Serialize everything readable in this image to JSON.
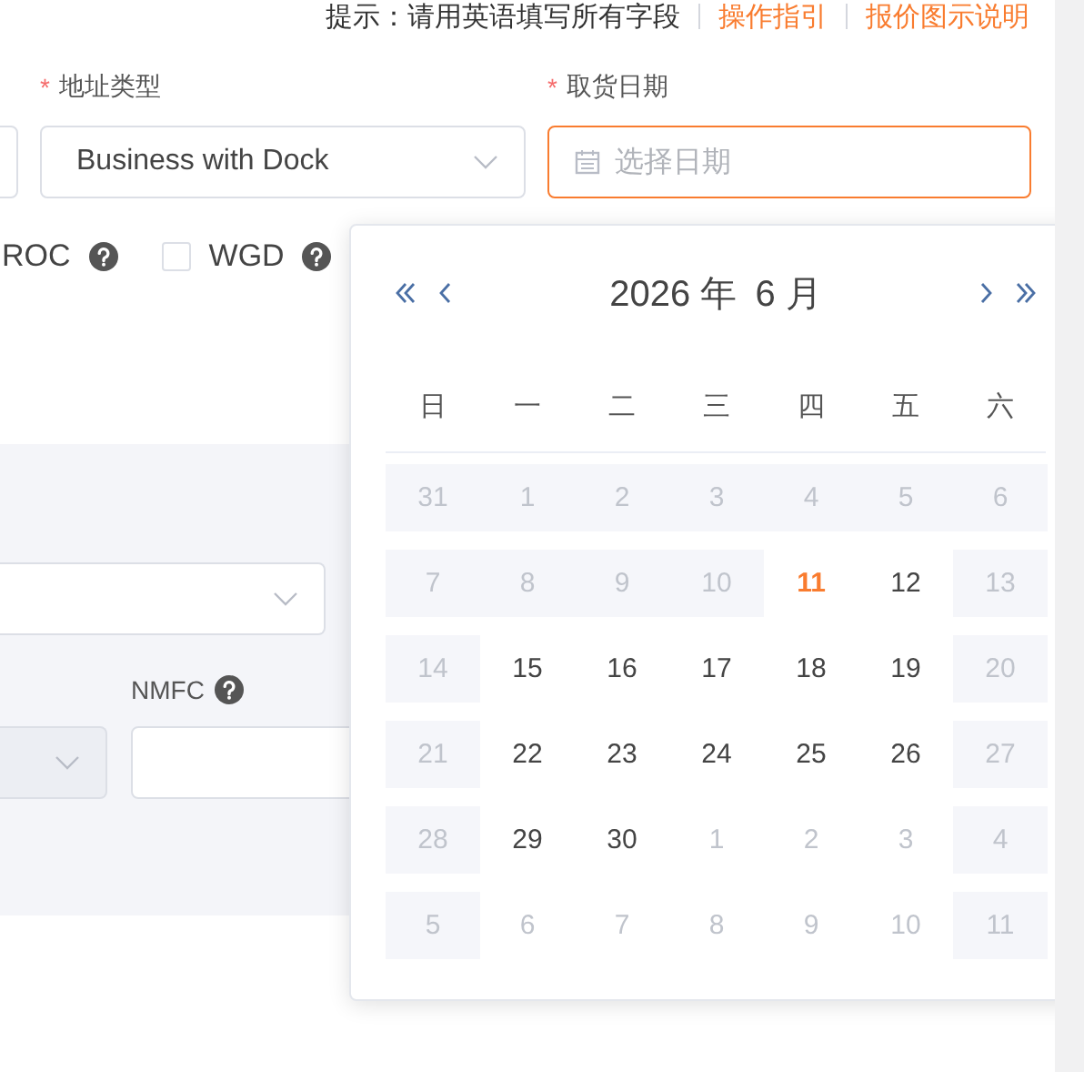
{
  "hint_bar": {
    "text": "提示：请用英语填写所有字段",
    "links": [
      "操作指引",
      "报价图示说明"
    ]
  },
  "fields": [
    {
      "kind": "input"
    },
    {
      "kind": "select",
      "marker": "*",
      "label": "地址类型",
      "value": "Business with Dock"
    },
    {
      "kind": "date",
      "marker": "*",
      "label": "取货日期",
      "placeholder": "选择日期",
      "focused": true
    }
  ],
  "options": [
    {
      "kind": "text",
      "label": "ROC",
      "help": true
    },
    {
      "kind": "checkbox",
      "label": "WGD",
      "checked": false,
      "help": true
    }
  ],
  "freight_panel": {
    "selects": [
      {
        "disabled": false
      },
      {
        "disabled": true
      }
    ],
    "nmfc": {
      "label": "NMFC",
      "help": true
    }
  },
  "calendar": {
    "year": "2026 年",
    "month": "6 月",
    "weekdays": [
      "日",
      "一",
      "二",
      "三",
      "四",
      "五",
      "六"
    ],
    "days": [
      {
        "label": "31",
        "kind": "disabled"
      },
      {
        "label": "1",
        "kind": "disabled"
      },
      {
        "label": "2",
        "kind": "disabled"
      },
      {
        "label": "3",
        "kind": "disabled"
      },
      {
        "label": "4",
        "kind": "disabled"
      },
      {
        "label": "5",
        "kind": "disabled"
      },
      {
        "label": "6",
        "kind": "disabled"
      },
      {
        "label": "7",
        "kind": "disabled"
      },
      {
        "label": "8",
        "kind": "disabled"
      },
      {
        "label": "9",
        "kind": "disabled"
      },
      {
        "label": "10",
        "kind": "disabled"
      },
      {
        "label": "11",
        "kind": "today"
      },
      {
        "label": "12",
        "kind": "normal"
      },
      {
        "label": "13",
        "kind": "disabled"
      },
      {
        "label": "14",
        "kind": "disabled"
      },
      {
        "label": "15",
        "kind": "normal"
      },
      {
        "label": "16",
        "kind": "normal"
      },
      {
        "label": "17",
        "kind": "normal"
      },
      {
        "label": "18",
        "kind": "normal"
      },
      {
        "label": "19",
        "kind": "normal"
      },
      {
        "label": "20",
        "kind": "disabled"
      },
      {
        "label": "21",
        "kind": "disabled"
      },
      {
        "label": "22",
        "kind": "normal"
      },
      {
        "label": "23",
        "kind": "normal"
      },
      {
        "label": "24",
        "kind": "normal"
      },
      {
        "label": "25",
        "kind": "normal"
      },
      {
        "label": "26",
        "kind": "normal"
      },
      {
        "label": "27",
        "kind": "disabled"
      },
      {
        "label": "28",
        "kind": "disabled"
      },
      {
        "label": "29",
        "kind": "normal"
      },
      {
        "label": "30",
        "kind": "normal"
      },
      {
        "label": "1",
        "kind": "muted"
      },
      {
        "label": "2",
        "kind": "muted"
      },
      {
        "label": "3",
        "kind": "muted"
      },
      {
        "label": "4",
        "kind": "disabled"
      },
      {
        "label": "5",
        "kind": "disabled"
      },
      {
        "label": "6",
        "kind": "muted"
      },
      {
        "label": "7",
        "kind": "muted"
      },
      {
        "label": "8",
        "kind": "muted"
      },
      {
        "label": "9",
        "kind": "muted"
      },
      {
        "label": "10",
        "kind": "muted"
      },
      {
        "label": "11",
        "kind": "disabled"
      }
    ]
  }
}
